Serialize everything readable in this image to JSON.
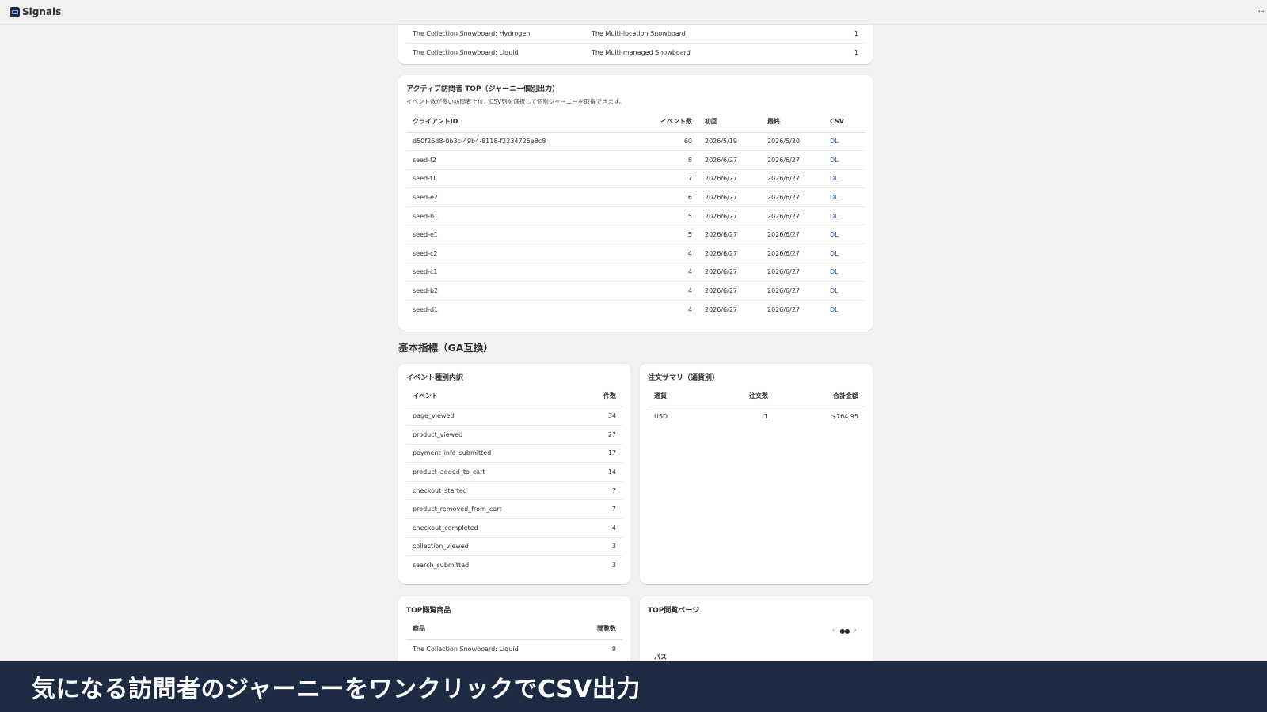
{
  "app": {
    "title": "Signals",
    "more": "···"
  },
  "top_products_table": {
    "rows": [
      [
        "The Collection Snowboard: Hydrogen",
        "The Multi-location Snowboard",
        "1"
      ],
      [
        "The Collection Snowboard: Liquid",
        "The Multi-managed Snowboard",
        "1"
      ]
    ]
  },
  "active_visitors": {
    "title": "アクティブ訪問者 TOP（ジャーニー個別出力）",
    "subtitle": "イベント数が多い訪問者上位。CSV列を選択して個別ジャーニーを取得できます。",
    "headers": [
      "クライアントID",
      "イベント数",
      "初回",
      "最終",
      "CSV"
    ],
    "rows": [
      [
        "d50f26d8-0b3c-49b4-8118-f2234725e8c8",
        "60",
        "2026/5/19",
        "2026/5/20",
        "DL"
      ],
      [
        "seed-f2",
        "8",
        "2026/6/27",
        "2026/6/27",
        "DL"
      ],
      [
        "seed-f1",
        "7",
        "2026/6/27",
        "2026/6/27",
        "DL"
      ],
      [
        "seed-e2",
        "6",
        "2026/6/27",
        "2026/6/27",
        "DL"
      ],
      [
        "seed-b1",
        "5",
        "2026/6/27",
        "2026/6/27",
        "DL"
      ],
      [
        "seed-e1",
        "5",
        "2026/6/27",
        "2026/6/27",
        "DL"
      ],
      [
        "seed-c2",
        "4",
        "2026/6/27",
        "2026/6/27",
        "DL"
      ],
      [
        "seed-c1",
        "4",
        "2026/6/27",
        "2026/6/27",
        "DL"
      ],
      [
        "seed-b2",
        "4",
        "2026/6/27",
        "2026/6/27",
        "DL"
      ],
      [
        "seed-d1",
        "4",
        "2026/6/27",
        "2026/6/27",
        "DL"
      ]
    ]
  },
  "basic_metrics": {
    "title": "基本指標（GA互換）"
  },
  "event_breakdown": {
    "title": "イベント種別内訳",
    "headers": [
      "イベント",
      "件数"
    ],
    "rows": [
      [
        "page_viewed",
        "34"
      ],
      [
        "product_viewed",
        "27"
      ],
      [
        "payment_info_submitted",
        "17"
      ],
      [
        "product_added_to_cart",
        "14"
      ],
      [
        "checkout_started",
        "7"
      ],
      [
        "product_removed_from_cart",
        "7"
      ],
      [
        "checkout_completed",
        "4"
      ],
      [
        "collection_viewed",
        "3"
      ],
      [
        "search_submitted",
        "3"
      ]
    ]
  },
  "order_summary": {
    "title": "注文サマリ（通貨別）",
    "headers": [
      "通貨",
      "注文数",
      "合計金額"
    ],
    "rows": [
      [
        "USD",
        "1",
        "$764.95"
      ]
    ]
  },
  "top_viewed_products": {
    "title": "TOP閲覧商品",
    "headers": [
      "商品",
      "閲覧数"
    ],
    "rows": [
      [
        "The Collection Snowboard: Liquid",
        "9"
      ]
    ]
  },
  "top_viewed_pages": {
    "title": "TOP閲覧ページ",
    "headers": [
      "パス"
    ],
    "pager_prev": "‹",
    "pager_dots": "●●",
    "pager_next": "›"
  },
  "caption": {
    "text": "気になる訪問者のジャーニーをワンクリックでCSV出力"
  }
}
